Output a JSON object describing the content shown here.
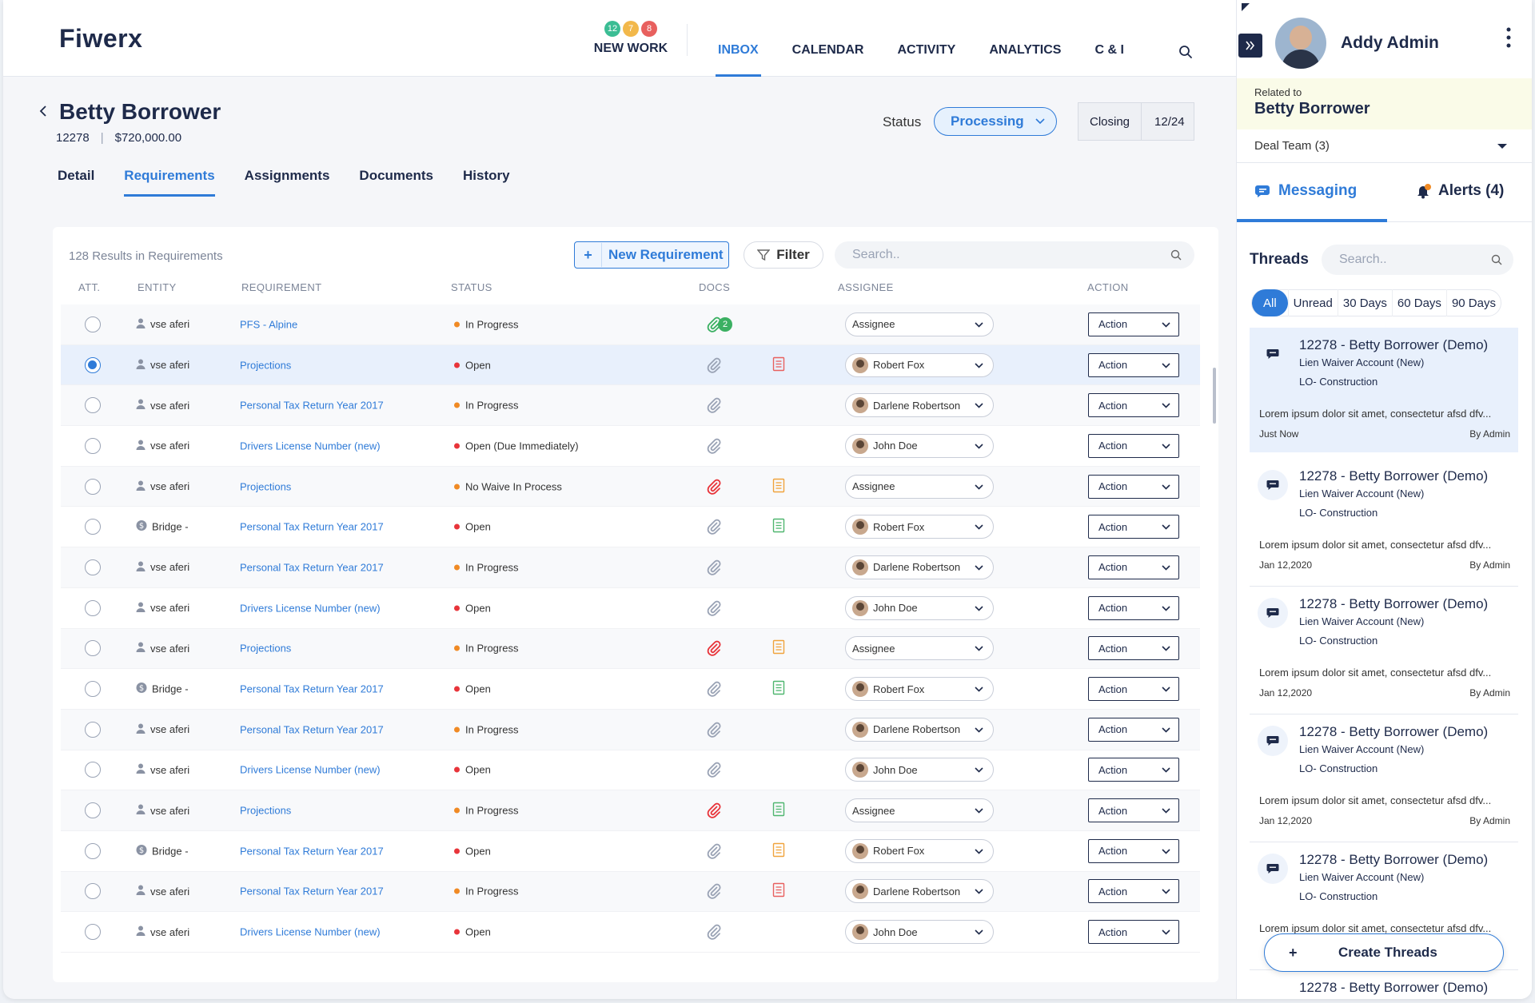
{
  "brand": {
    "logo": "Fiwerx"
  },
  "nav": {
    "new_work": {
      "label": "NEW WORK",
      "badges": [
        {
          "value": "12",
          "color": "#3bbd94"
        },
        {
          "value": "7",
          "color": "#f2b84b"
        },
        {
          "value": "8",
          "color": "#e8605e"
        }
      ]
    },
    "links": [
      "INBOX",
      "CALENDAR",
      "ACTIVITY",
      "ANALYTICS",
      "C & I"
    ],
    "active": "INBOX"
  },
  "loan": {
    "borrower": "Betty Borrower",
    "id": "12278",
    "amount": "$720,000.00",
    "status_label": "Status",
    "status_value": "Processing",
    "closing_label": "Closing",
    "closing_value": "12/24"
  },
  "tabs": [
    "Detail",
    "Requirements",
    "Assignments",
    "Documents",
    "History"
  ],
  "active_tab": "Requirements",
  "requirements": {
    "results_text": "128 Results in Requirements",
    "new_button": "New Requirement",
    "filter_button": "Filter",
    "search_placeholder": "Search..",
    "columns": [
      "ATT.",
      "ENTITY",
      "REQUIREMENT",
      "STATUS",
      "DOCS",
      "ASSIGNEE",
      "ACTION"
    ],
    "action_label": "Action",
    "rows": [
      {
        "selected": false,
        "entity": "vse aferi",
        "entity_icon": "person-icon",
        "requirement": "PFS - Alpine",
        "status": "In Progress",
        "status_color": "#f08a24",
        "clip": "green",
        "clip_count": "2",
        "doc": "",
        "assignee": "Assignee",
        "avatar": false
      },
      {
        "selected": true,
        "entity": "vse aferi",
        "entity_icon": "person-icon",
        "requirement": "Projections",
        "status": "Open",
        "status_color": "#e8343a",
        "clip": "gray",
        "clip_count": "",
        "doc": "red",
        "assignee": "Robert Fox",
        "avatar": true
      },
      {
        "selected": false,
        "entity": "vse aferi",
        "entity_icon": "person-icon",
        "requirement": "Personal Tax Return Year 2017",
        "status": "In Progress",
        "status_color": "#f08a24",
        "clip": "gray",
        "clip_count": "",
        "doc": "",
        "assignee": "Darlene Robertson",
        "avatar": true
      },
      {
        "selected": false,
        "entity": "vse aferi",
        "entity_icon": "person-icon",
        "requirement": "Drivers License Number (new)",
        "status": "Open (Due Immediately)",
        "status_color": "#e8343a",
        "clip": "gray",
        "clip_count": "",
        "doc": "",
        "assignee": "John Doe",
        "avatar": true
      },
      {
        "selected": false,
        "entity": "vse aferi",
        "entity_icon": "person-icon",
        "requirement": "Projections",
        "status": "No Waive In Process",
        "status_color": "#f08a24",
        "clip": "red",
        "clip_count": "",
        "doc": "orange",
        "assignee": "Assignee",
        "avatar": false
      },
      {
        "selected": false,
        "entity": "Bridge -",
        "entity_icon": "dollar-icon",
        "requirement": "Personal Tax Return Year 2017",
        "status": "Open",
        "status_color": "#e8343a",
        "clip": "gray",
        "clip_count": "",
        "doc": "green",
        "assignee": "Robert Fox",
        "avatar": true
      },
      {
        "selected": false,
        "entity": "vse aferi",
        "entity_icon": "person-icon",
        "requirement": "Personal Tax Return Year 2017",
        "status": "In Progress",
        "status_color": "#f08a24",
        "clip": "gray",
        "clip_count": "",
        "doc": "",
        "assignee": "Darlene Robertson",
        "avatar": true
      },
      {
        "selected": false,
        "entity": "vse aferi",
        "entity_icon": "person-icon",
        "requirement": "Drivers License Number (new)",
        "status": "Open",
        "status_color": "#e8343a",
        "clip": "gray",
        "clip_count": "",
        "doc": "",
        "assignee": "John Doe",
        "avatar": true
      },
      {
        "selected": false,
        "entity": "vse aferi",
        "entity_icon": "person-icon",
        "requirement": "Projections",
        "status": "In Progress",
        "status_color": "#f08a24",
        "clip": "red",
        "clip_count": "",
        "doc": "orange",
        "assignee": "Assignee",
        "avatar": false
      },
      {
        "selected": false,
        "entity": "Bridge -",
        "entity_icon": "dollar-icon",
        "requirement": "Personal Tax Return Year 2017",
        "status": "Open",
        "status_color": "#e8343a",
        "clip": "gray",
        "clip_count": "",
        "doc": "green",
        "assignee": "Robert Fox",
        "avatar": true
      },
      {
        "selected": false,
        "entity": "vse aferi",
        "entity_icon": "person-icon",
        "requirement": "Personal Tax Return Year 2017",
        "status": "In Progress",
        "status_color": "#f08a24",
        "clip": "gray",
        "clip_count": "",
        "doc": "",
        "assignee": "Darlene Robertson",
        "avatar": true
      },
      {
        "selected": false,
        "entity": "vse aferi",
        "entity_icon": "person-icon",
        "requirement": "Drivers License Number (new)",
        "status": "Open",
        "status_color": "#e8343a",
        "clip": "gray",
        "clip_count": "",
        "doc": "",
        "assignee": "John Doe",
        "avatar": true
      },
      {
        "selected": false,
        "entity": "vse aferi",
        "entity_icon": "person-icon",
        "requirement": "Projections",
        "status": "In Progress",
        "status_color": "#f08a24",
        "clip": "red",
        "clip_count": "",
        "doc": "green",
        "assignee": "Assignee",
        "avatar": false
      },
      {
        "selected": false,
        "entity": "Bridge -",
        "entity_icon": "dollar-icon",
        "requirement": "Personal Tax Return Year 2017",
        "status": "Open",
        "status_color": "#e8343a",
        "clip": "gray",
        "clip_count": "",
        "doc": "orange",
        "assignee": "Robert Fox",
        "avatar": true
      },
      {
        "selected": false,
        "entity": "vse aferi",
        "entity_icon": "person-icon",
        "requirement": "Personal Tax Return Year 2017",
        "status": "In Progress",
        "status_color": "#f08a24",
        "clip": "gray",
        "clip_count": "",
        "doc": "red",
        "assignee": "Darlene Robertson",
        "avatar": true
      },
      {
        "selected": false,
        "entity": "vse aferi",
        "entity_icon": "person-icon",
        "requirement": "Drivers License Number (new)",
        "status": "Open",
        "status_color": "#e8343a",
        "clip": "gray",
        "clip_count": "",
        "doc": "",
        "assignee": "John Doe",
        "avatar": true
      }
    ]
  },
  "panel": {
    "user_name": "Addy Admin",
    "related_label": "Related to",
    "related_name": "Betty Borrower",
    "deal_team": "Deal Team (3)",
    "tabs": {
      "messaging": "Messaging",
      "alerts": "Alerts (4)"
    },
    "threads_label": "Threads",
    "search_placeholder": "Search..",
    "filters": [
      "All",
      "Unread",
      "30 Days",
      "60 Days",
      "90 Days"
    ],
    "active_filter": "All",
    "threads": [
      {
        "title": "12278 - Betty Borrower (Demo)",
        "sub": "Lien Waiver Account (New)",
        "sub2": "LO- Construction",
        "body": "Lorem ipsum dolor sit amet, consectetur afsd dfv...",
        "date": "Just Now",
        "by": "By Admin",
        "active": true
      },
      {
        "title": "12278 - Betty Borrower (Demo)",
        "sub": "Lien Waiver Account (New)",
        "sub2": "LO- Construction",
        "body": "Lorem ipsum dolor sit amet, consectetur afsd dfv...",
        "date": "Jan 12,2020",
        "by": "By Admin",
        "active": false
      },
      {
        "title": "12278 - Betty Borrower (Demo)",
        "sub": "Lien Waiver Account (New)",
        "sub2": "LO- Construction",
        "body": "Lorem ipsum dolor sit amet, consectetur afsd dfv...",
        "date": "Jan 12,2020",
        "by": "By Admin",
        "active": false
      },
      {
        "title": "12278 - Betty Borrower (Demo)",
        "sub": "Lien Waiver Account (New)",
        "sub2": "LO- Construction",
        "body": "Lorem ipsum dolor sit amet, consectetur afsd dfv...",
        "date": "Jan 12,2020",
        "by": "By Admin",
        "active": false
      },
      {
        "title": "12278 - Betty Borrower (Demo)",
        "sub": "Lien Waiver Account (New)",
        "sub2": "LO- Construction",
        "body": "Lorem ipsum dolor sit amet, consectetur afsd dfv...",
        "date": "",
        "by": "",
        "active": false
      }
    ],
    "peek_title": "12278 - Betty Borrower (Demo)",
    "create_button": "Create Threads"
  },
  "colors": {
    "accent": "#2f7bd8",
    "navy": "#1e2a4a",
    "open": "#e8343a",
    "progress": "#f08a24"
  }
}
